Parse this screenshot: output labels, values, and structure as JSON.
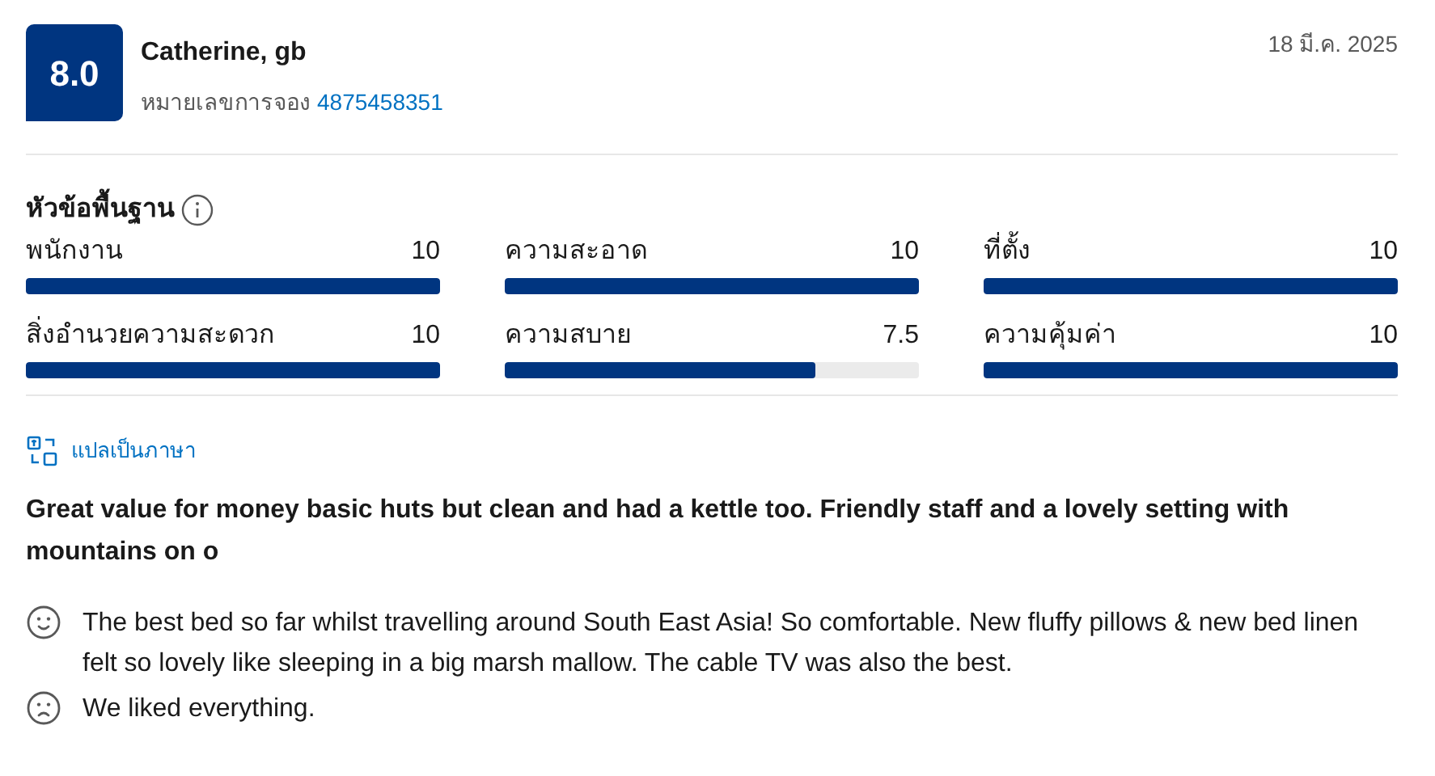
{
  "score": "8.0",
  "reviewer": "Catherine, gb",
  "booking_label": "หมายเลขการจอง",
  "booking_number": "4875458351",
  "date": "18 มี.ค. 2025",
  "categories_title": "หัวข้อพื้นฐาน",
  "categories": [
    {
      "name": "พนักงาน",
      "value": "10",
      "level": 1
    },
    {
      "name": "ความสะอาด",
      "value": "10",
      "level": 1
    },
    {
      "name": "ที่ตั้ง",
      "value": "10",
      "level": 1
    },
    {
      "name": "สิ่งอำนวยความสะดวก",
      "value": "10",
      "level": 1
    },
    {
      "name": "ความสบาย",
      "value": "7.5",
      "level": 0.75
    },
    {
      "name": "ความคุ้มค่า",
      "value": "10",
      "level": 1
    }
  ],
  "translate_link": "แปลเป็นภาษา",
  "headline": "Great value for money basic huts but clean and had a kettle too. Friendly staff and a lovely setting with mountains on o",
  "comments": [
    {
      "kind": "positive",
      "text": "The best bed so far whilst travelling around South East Asia! So comfortable. New fluffy pillows & new bed linen felt so lovely like sleeping in a big marsh mallow. The cable TV was also the best."
    },
    {
      "kind": "negative",
      "text": "We liked everything."
    }
  ]
}
